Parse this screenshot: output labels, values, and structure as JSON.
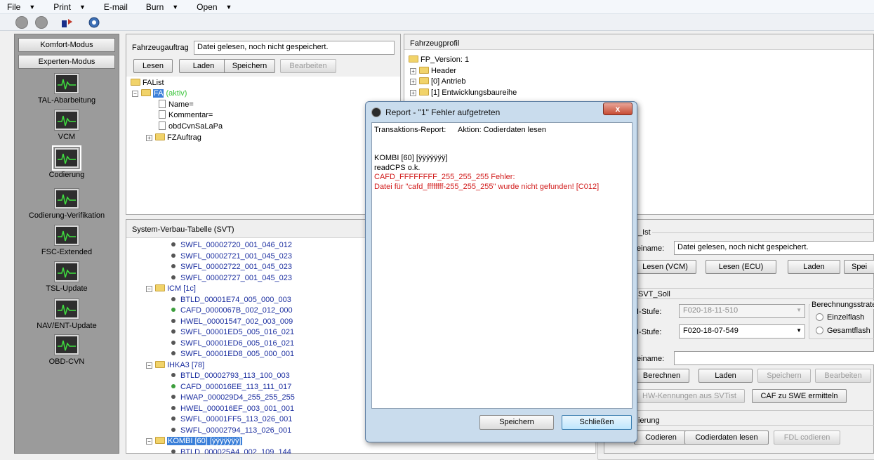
{
  "menubar": {
    "items": [
      "File",
      "Print",
      "E-mail",
      "Burn",
      "Open"
    ]
  },
  "sidebar": {
    "mode_buttons": [
      "Komfort-Modus",
      "Experten-Modus"
    ],
    "items": [
      "TAL-Abarbeitung",
      "VCM",
      "Codierung",
      "Codierung-Verifikation",
      "FSC-Extended",
      "TSL-Update",
      "NAV/ENT-Update",
      "OBD-CVN"
    ]
  },
  "fa_panel": {
    "label": "Fahrzeugauftrag",
    "value": "Datei gelesen, noch nicht gespeichert.",
    "buttons": [
      "Lesen",
      "Laden",
      "Speichern",
      "Bearbeiten"
    ],
    "tree": {
      "root": "FAList",
      "node": "FA",
      "node_status": "(aktiv)",
      "children": [
        "Name=",
        "Kommentar=",
        "obdCvnSaLaPa",
        "FZAuftrag"
      ]
    }
  },
  "fp_panel": {
    "title": "Fahrzeugprofil",
    "tree": [
      "FP_Version: 1",
      "Header",
      "[0] Antrieb",
      "[1] Entwicklungsbaureihe"
    ]
  },
  "svt_panel": {
    "title": "System-Verbau-Tabelle (SVT)",
    "rows": [
      {
        "t": "leaf",
        "text": "SWFL_00002720_001_046_012"
      },
      {
        "t": "leaf",
        "text": "SWFL_00002721_001_045_023"
      },
      {
        "t": "leaf",
        "text": "SWFL_00002722_001_045_023"
      },
      {
        "t": "leaf",
        "text": "SWFL_00002727_001_045_023"
      },
      {
        "t": "group",
        "text": "ICM [1c]"
      },
      {
        "t": "leaf",
        "text": "BTLD_00001E74_005_000_003"
      },
      {
        "t": "leafg",
        "text": "CAFD_0000067B_002_012_000"
      },
      {
        "t": "leaf",
        "text": "HWEL_00001547_002_003_009"
      },
      {
        "t": "leaf",
        "text": "SWFL_00001ED5_005_016_021"
      },
      {
        "t": "leaf",
        "text": "SWFL_00001ED6_005_016_021"
      },
      {
        "t": "leaf",
        "text": "SWFL_00001ED8_005_000_001"
      },
      {
        "t": "group",
        "text": "IHKA3 [78]"
      },
      {
        "t": "leaf",
        "text": "BTLD_00002793_113_100_003"
      },
      {
        "t": "leafg",
        "text": "CAFD_000016EE_113_111_017"
      },
      {
        "t": "leaf",
        "text": "HWAP_000029D4_255_255_255"
      },
      {
        "t": "leaf",
        "text": "HWEL_000016EF_003_001_001"
      },
      {
        "t": "leaf",
        "text": "SWFL_00001FF5_113_026_001"
      },
      {
        "t": "leaf",
        "text": "SWFL_00002794_113_026_001"
      },
      {
        "t": "groupsel",
        "text": "KOMBI [60] [ÿÿÿÿÿÿÿ]"
      },
      {
        "t": "leaf",
        "text": "BTLD_000025A4_002_109_144"
      }
    ]
  },
  "right_panel": {
    "svt_ist_title": "_Ist",
    "name_label": "einame:",
    "name_value": "Datei gelesen, noch nicht gespeichert.",
    "ist_buttons": [
      "Lesen (VCM)",
      "Lesen (ECU)",
      "Laden",
      "Spei"
    ],
    "svt_soll_title": "SVT_Soll",
    "stufe1_label": "I-Stufe:",
    "stufe1_value": "F020-18-11-510",
    "stufe2_label": "I-Stufe:",
    "stufe2_value": "F020-18-07-549",
    "berech_title": "Berechnungsstrate",
    "radio1": "Einzelflash",
    "radio2": "Gesamtflash",
    "name2_label": "einame:",
    "soll_buttons": [
      "Berechnen",
      "Laden",
      "Speichern",
      "Bearbeiten"
    ],
    "hw_button": "HW-Kennungen aus SVTist",
    "caf_button": "CAF zu SWE ermitteln",
    "cod_title": "ierung",
    "cod_buttons": [
      "Codieren",
      "Codierdaten lesen",
      "FDL codieren"
    ]
  },
  "dialog": {
    "title": "Report - \"1\" Fehler aufgetreten",
    "close_glyph": "x",
    "header_left": "Transaktions-Report:",
    "header_right": "Aktion: Codierdaten lesen",
    "lines": [
      {
        "text": "KOMBI [60] [ÿÿÿÿÿÿÿ]",
        "err": false
      },
      {
        "text": "readCPS o.k.",
        "err": false
      },
      {
        "text": "CAFD_FFFFFFFF_255_255_255 Fehler:",
        "err": true
      },
      {
        "text": "Datei für \"cafd_ffffffff-255_255_255\" wurde nicht gefunden! [C012]",
        "err": true
      }
    ],
    "buttons": [
      "Speichern",
      "Schließen"
    ]
  }
}
